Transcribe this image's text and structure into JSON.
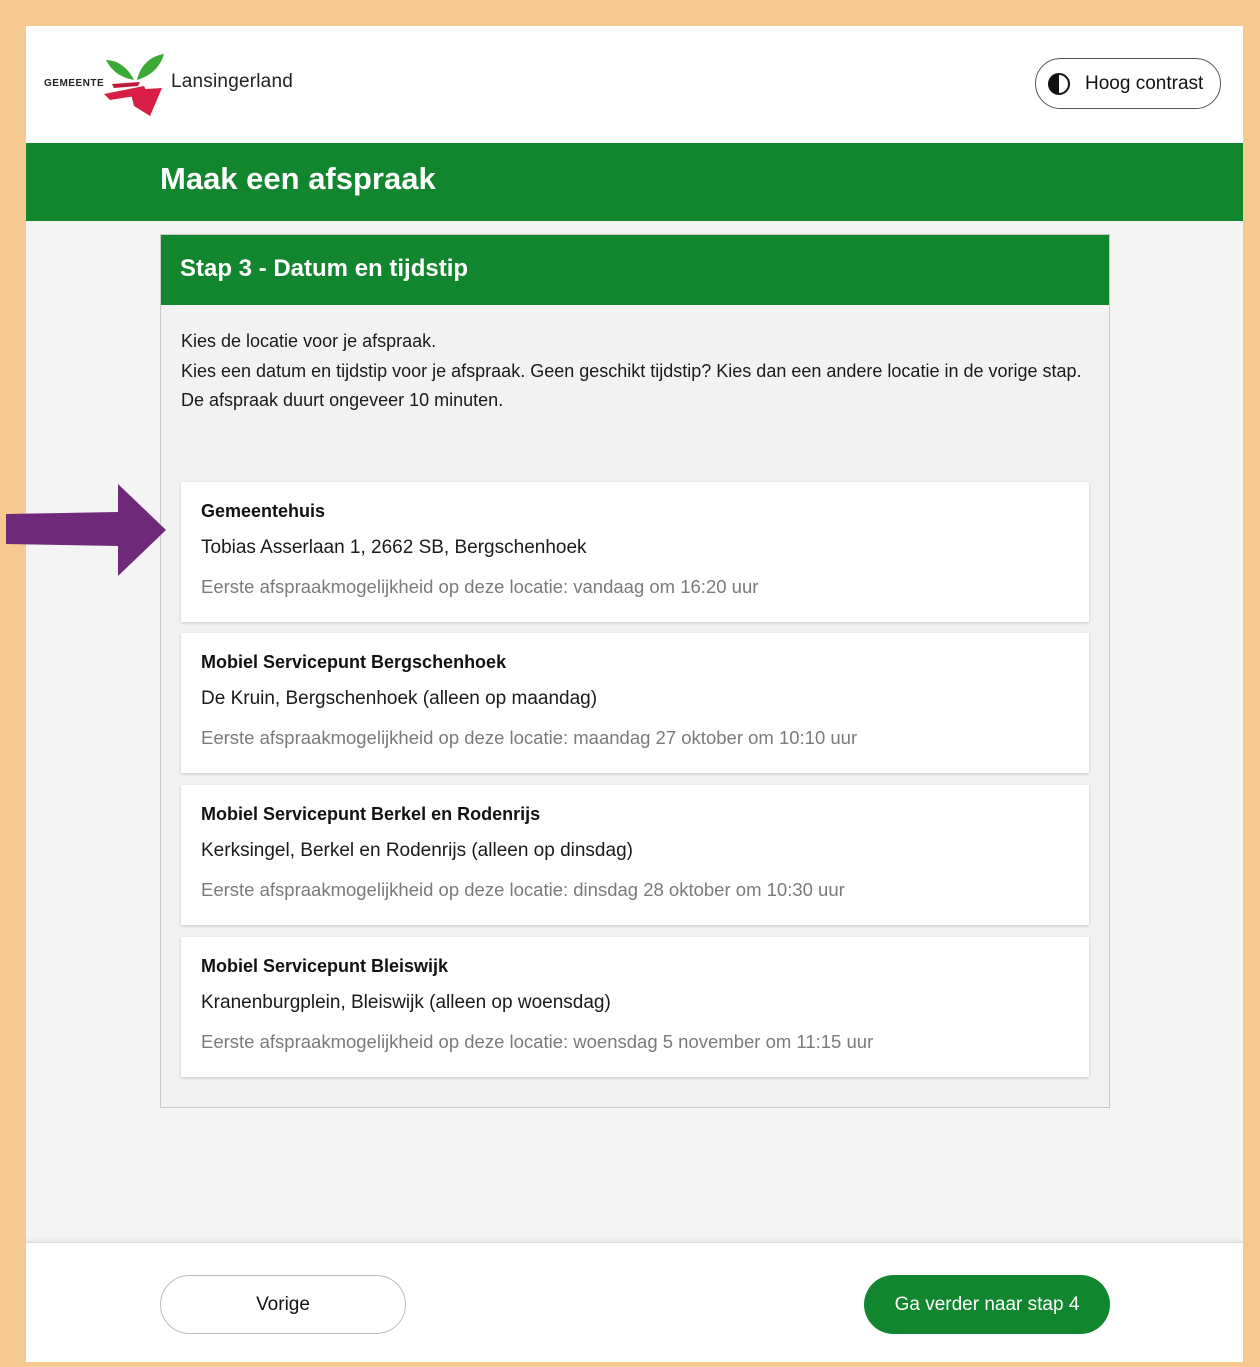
{
  "header": {
    "logo_small_text": "GEMEENTE",
    "logo_name": "Lansingerland",
    "contrast_button_label": "Hoog contrast"
  },
  "banner": {
    "title": "Maak een afspraak"
  },
  "step": {
    "title": "Stap 3 - Datum en tijdstip",
    "intro_line1": "Kies de locatie voor je afspraak.",
    "intro_line2": "Kies een datum en tijdstip voor je afspraak. Geen geschikt tijdstip? Kies dan een andere locatie in de vorige stap.",
    "intro_line3": "De afspraak duurt ongeveer 10 minuten."
  },
  "locations": [
    {
      "name": "Gemeentehuis",
      "address": "Tobias Asserlaan 1, 2662 SB, Bergschenhoek",
      "first_available": "Eerste afspraakmogelijkheid op deze locatie: vandaag om 16:20 uur"
    },
    {
      "name": "Mobiel Servicepunt Bergschenhoek",
      "address": "De Kruin, Bergschenhoek (alleen op maandag)",
      "first_available": "Eerste afspraakmogelijkheid op deze locatie: maandag 27 oktober om 10:10 uur"
    },
    {
      "name": "Mobiel Servicepunt Berkel en Rodenrijs",
      "address": "Kerksingel, Berkel en Rodenrijs (alleen op dinsdag)",
      "first_available": "Eerste afspraakmogelijkheid op deze locatie: dinsdag 28 oktober om 10:30 uur"
    },
    {
      "name": "Mobiel Servicepunt Bleiswijk",
      "address": "Kranenburgplein, Bleiswijk (alleen op woensdag)",
      "first_available": "Eerste afspraakmogelijkheid op deze locatie: woensdag 5 november om 11:15 uur"
    }
  ],
  "footer": {
    "prev_label": "Vorige",
    "next_label": "Ga verder naar stap 4"
  },
  "colors": {
    "brand_green": "#11862f",
    "outer_border": "#f5c990",
    "arrow_purple": "#6e2a78"
  }
}
